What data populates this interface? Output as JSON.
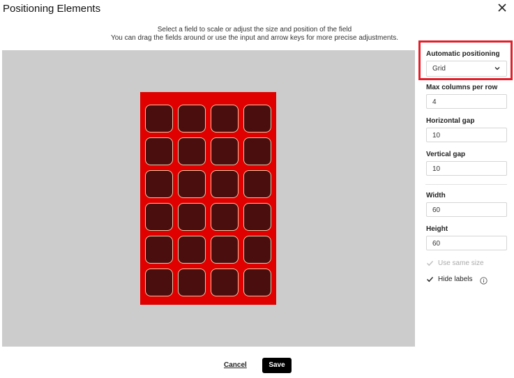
{
  "dialog": {
    "title": "Positioning Elements",
    "close_icon": "close-icon"
  },
  "instructions": {
    "line1": "Select a field to scale or adjust the size and position of the field",
    "line2": "You can drag the fields around or use the input and arrow keys for more precise adjustments."
  },
  "canvas": {
    "background_color": "#cccccc",
    "board_color": "#e00000",
    "cell_color": "#4a0e0e",
    "cell_border_color": "#e8c9a8",
    "rows": 6,
    "columns": 4
  },
  "panel": {
    "auto_positioning": {
      "label": "Automatic positioning",
      "value": "Grid",
      "icon": "chevron-down-icon"
    },
    "max_columns": {
      "label": "Max columns per row",
      "value": "4"
    },
    "horizontal_gap": {
      "label": "Horizontal gap",
      "value": "10"
    },
    "vertical_gap": {
      "label": "Vertical gap",
      "value": "10"
    },
    "width": {
      "label": "Width",
      "value": "60"
    },
    "height": {
      "label": "Height",
      "value": "60"
    },
    "use_same_size": {
      "label": "Use same size",
      "checked": true,
      "disabled": true
    },
    "hide_labels": {
      "label": "Hide labels",
      "checked": true,
      "info_icon": "info-icon"
    },
    "highlight_color": "#e41d2a"
  },
  "footer": {
    "cancel_label": "Cancel",
    "save_label": "Save"
  }
}
